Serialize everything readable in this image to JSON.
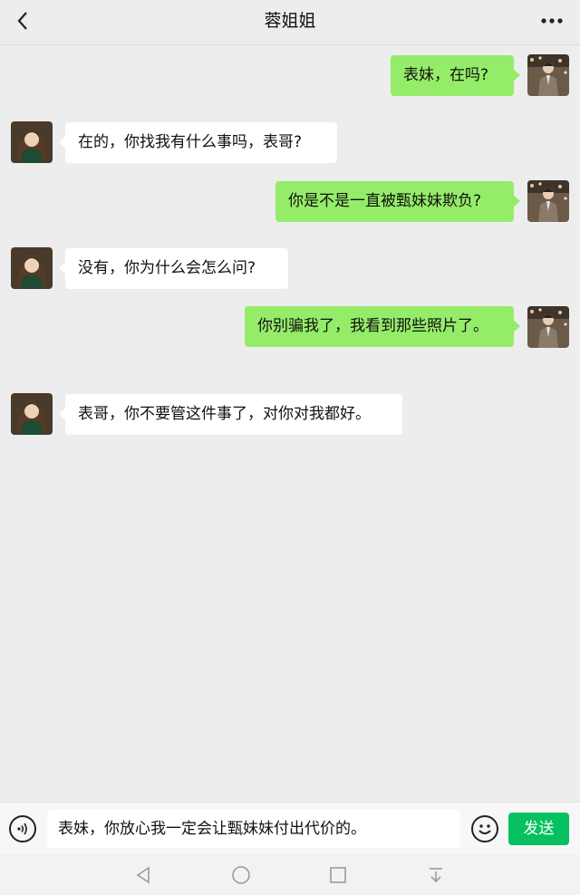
{
  "header": {
    "title": "蓉姐姐",
    "back_icon": "chevron-left-icon",
    "more_icon": "more-dots-icon"
  },
  "messages": [
    {
      "side": "right",
      "text": "表妹，在吗?"
    },
    {
      "side": "left",
      "text": "在的，你找我有什么事吗，表哥?"
    },
    {
      "side": "right",
      "text": "你是不是一直被甄妹妹欺负?"
    },
    {
      "side": "left",
      "text": "没有，你为什么会怎么问?"
    },
    {
      "side": "right",
      "text": "你别骗我了，我看到那些照片了。"
    },
    {
      "side": "left",
      "text": "表哥，你不要管这件事了，对你对我都好。"
    }
  ],
  "input": {
    "value": "表妹，你放心我一定会让甄妹妹付出代价的。",
    "voice_icon": "voice-icon",
    "emoji_icon": "emoji-icon",
    "send_label": "发送"
  },
  "nav": {
    "icons": [
      "back-triangle-icon",
      "home-circle-icon",
      "recents-square-icon",
      "download-icon"
    ]
  },
  "colors": {
    "background": "#ededed",
    "sent_bubble": "#95ec69",
    "received_bubble": "#ffffff",
    "send_button": "#07c160"
  }
}
